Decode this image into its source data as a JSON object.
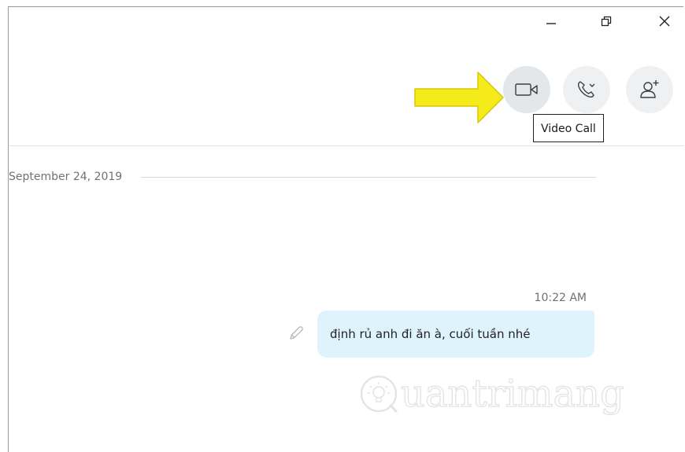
{
  "window_controls": {
    "minimize": "minimize-icon",
    "restore": "restore-icon",
    "close": "close-icon"
  },
  "toolbar": {
    "video_call_icon": "video-camera-icon",
    "audio_call_icon": "phone-dropdown-icon",
    "add_people_icon": "add-person-icon",
    "tooltip": "Video Call"
  },
  "conversation": {
    "date_separator": "September 24, 2019",
    "messages": [
      {
        "time": "10:22 AM",
        "text": "định rủ anh đi ăn à, cuối tuần nhé"
      }
    ]
  },
  "annotation": {
    "arrow_color": "#f5ea1a"
  },
  "watermark": {
    "text": "uantrimang"
  },
  "colors": {
    "bubble": "#dff3fd",
    "button_bg": "#eef0f2",
    "muted_text": "#6c7378"
  }
}
